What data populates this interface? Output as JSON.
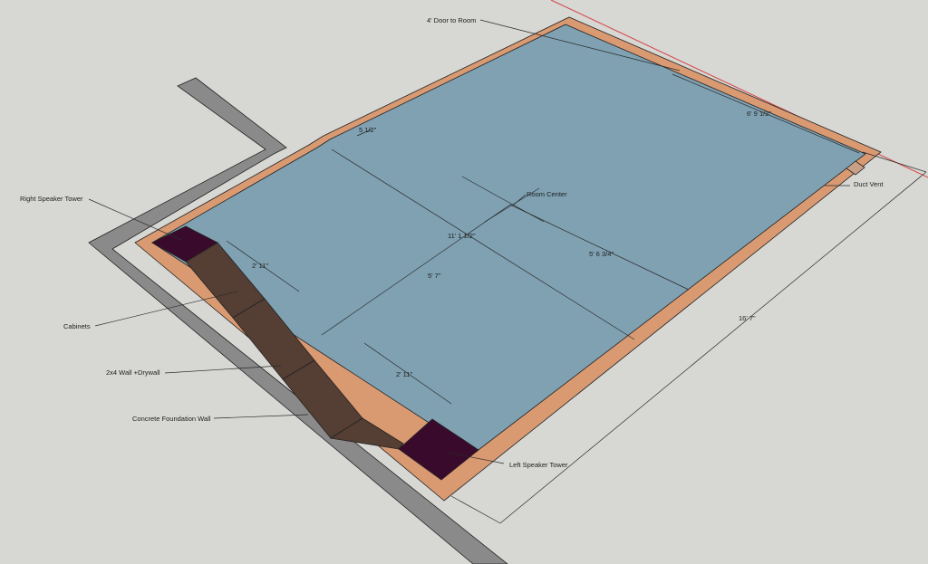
{
  "colors": {
    "background": "#d7d7d4",
    "foundation": "#8a8a8a",
    "drywall": "#d99a72",
    "floor": "#7fa1b2",
    "cabinet": "#553e33",
    "speaker": "#3a0a2c",
    "boundary_line": "#d64545"
  },
  "labels": {
    "door": "4' Door to Room",
    "duct_vent": "Duct Vent",
    "right_speaker": "Right Speaker Tower",
    "cabinets": "Cabinets",
    "wall_2x4": "2x4 Wall +Drywall",
    "foundation": "Concrete Foundation Wall",
    "left_speaker": "Left Speaker Tower",
    "room_center": "Room Center"
  },
  "dimensions": {
    "notch": "5 1/2\"",
    "door_offset": "6' 9 1/2\"",
    "room_length": "11' 1 1/2\"",
    "center_to_far_wall": "5' 6 3/4\"",
    "center_to_cabinet_wall": "5' 7\"",
    "right_gap": "2' 11\"",
    "left_gap": "2' 11\"",
    "room_width": "16' 7\""
  }
}
